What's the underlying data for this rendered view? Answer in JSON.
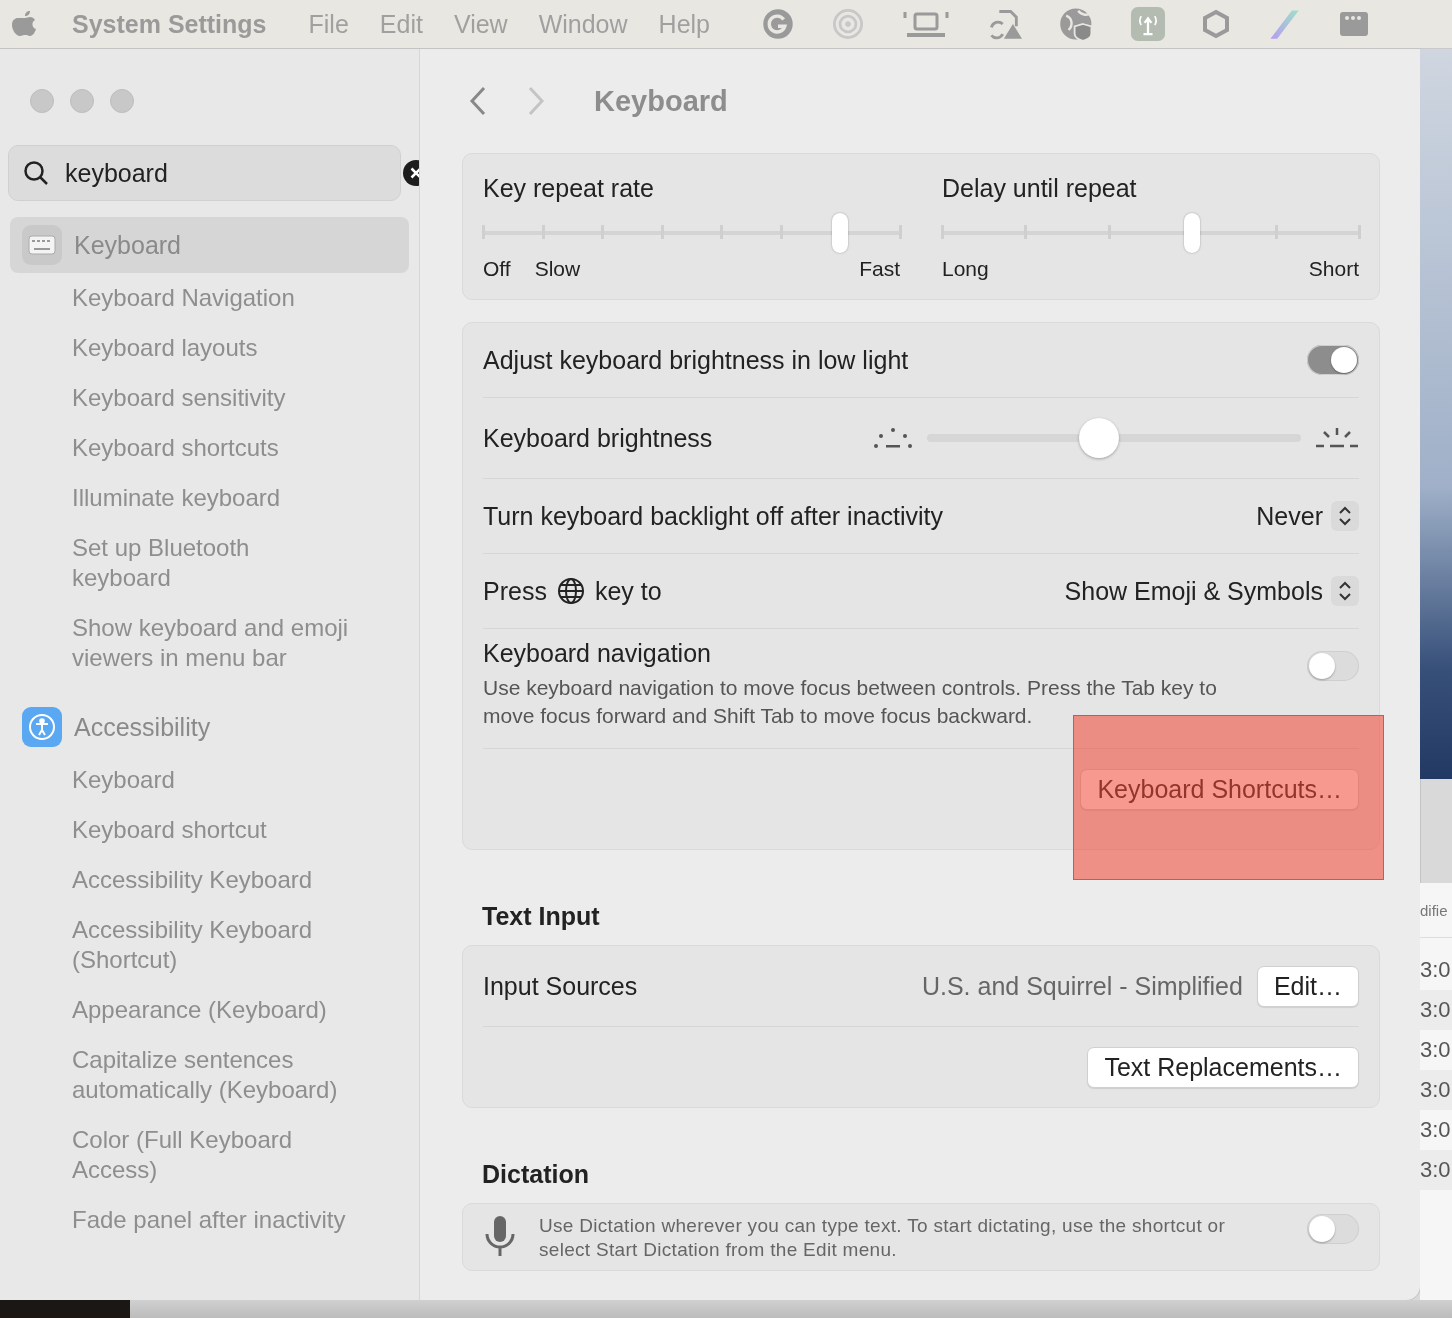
{
  "menu_bar": {
    "app_name": "System Settings",
    "menus": [
      "File",
      "Edit",
      "View",
      "Window",
      "Help"
    ]
  },
  "window": {
    "title": "Keyboard"
  },
  "search": {
    "value": "keyboard"
  },
  "sidebar": {
    "items": [
      {
        "label": "Keyboard",
        "selected": true,
        "children": [
          {
            "label": "Keyboard Navigation",
            "selected": false
          },
          {
            "label": "Keyboard layouts",
            "selected": false
          },
          {
            "label": "Keyboard sensitivity",
            "selected": false
          },
          {
            "label": "Keyboard shortcuts",
            "selected": false
          },
          {
            "label": "Illuminate keyboard",
            "selected": false
          },
          {
            "label": "Set up Bluetooth keyboard",
            "selected": false
          },
          {
            "label": "Show keyboard and emoji viewers in menu bar",
            "selected": false
          }
        ]
      },
      {
        "label": "Accessibility",
        "selected": false,
        "children": [
          {
            "label": "Keyboard",
            "selected": false
          },
          {
            "label": "Keyboard shortcut",
            "selected": false
          },
          {
            "label": "Accessibility Keyboard",
            "selected": false
          },
          {
            "label": "Accessibility Keyboard (Shortcut)",
            "selected": false
          },
          {
            "label": "Appearance (Keyboard)",
            "selected": false
          },
          {
            "label": "Capitalize sentences automatically (Keyboard)",
            "selected": false
          },
          {
            "label": "Color (Full Keyboard Access)",
            "selected": false
          },
          {
            "label": "Fade panel after inactivity",
            "selected": false
          }
        ]
      }
    ]
  },
  "repeat": [
    {
      "kind": "repeat_rate",
      "title": "Key repeat rate",
      "level": 0.857,
      "labels": [
        "Off",
        "Slow",
        "Fast"
      ]
    },
    {
      "kind": "delay",
      "title": "Delay until repeat",
      "level": 0.6,
      "labels": [
        "Long",
        "Short"
      ]
    }
  ],
  "settings": [
    {
      "kind": "toggle",
      "label": "Adjust keyboard brightness in low light",
      "on": true
    },
    {
      "kind": "slider",
      "label": "Keyboard brightness",
      "level": 0.46
    },
    {
      "kind": "popup",
      "label": "Turn keyboard backlight off after inactivity",
      "value": "Never"
    },
    {
      "kind": "globe_popup",
      "label": "Press",
      "label_after": "key to",
      "value": "Show Emoji & Symbols"
    },
    {
      "kind": "toggle",
      "label": "Keyboard navigation",
      "on": false,
      "description": "Use keyboard navigation to move focus between controls. Press the Tab key to move focus forward and Shift Tab to move focus backward."
    },
    {
      "kind": "button",
      "label": "Keyboard Shortcuts…",
      "highlighted": true
    }
  ],
  "text_input": {
    "heading": "Text Input",
    "rows": [
      {
        "kind": "value_button",
        "label": "Input Sources",
        "value": "U.S. and Squirrel - Simplified",
        "button": "Edit…"
      },
      {
        "kind": "button",
        "label": "Text Replacements…",
        "highlighted": false
      }
    ]
  },
  "dictation": {
    "heading": "Dictation",
    "description": "Use Dictation wherever you can type text. To start dictating, use the shortcut or select Start Dictation from the Edit menu.",
    "on": false
  },
  "background_window": {
    "column_header": "difie",
    "cells": [
      "3:0",
      "3:0",
      "3:0",
      "3:0",
      "3:0",
      "3:0"
    ]
  }
}
